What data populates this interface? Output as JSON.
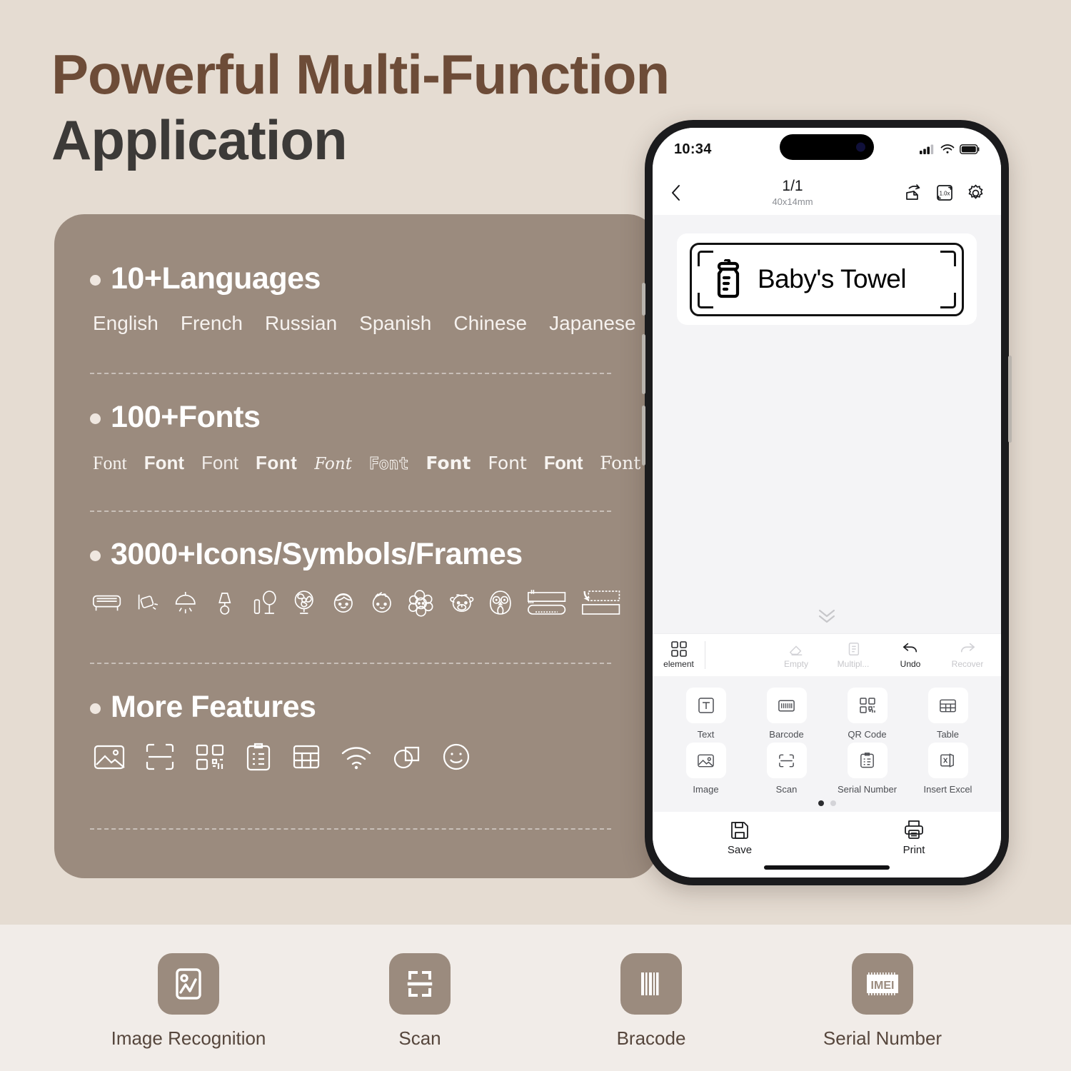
{
  "hero": {
    "title_line1": "Powerful Multi-Function",
    "title_line2": "Application",
    "colors": {
      "bg": "#e5dcd2",
      "title_brown": "#6d4c38",
      "title_dark": "#3c3a38",
      "card": "#9b8b7e",
      "strip_bg": "#f1ece8"
    }
  },
  "features": {
    "languages": {
      "heading": "10+Languages",
      "items": [
        "English",
        "French",
        "Russian",
        "Spanish",
        "Chinese",
        "Japanese"
      ]
    },
    "fonts": {
      "heading": "100+Fonts",
      "samples": [
        "Font",
        "Font",
        "Font",
        "Font",
        "Font",
        "Font",
        "Font",
        "Font",
        "Font",
        "Font"
      ]
    },
    "icons": {
      "heading": "3000+Icons/Symbols/Frames",
      "items": [
        "sofa-icon",
        "wall-lamp-icon",
        "ceiling-light-icon",
        "table-lamp-icon",
        "floor-lamp-icon",
        "fan-icon",
        "boy-face-icon",
        "child-face-icon",
        "poodle-icon",
        "cow-icon",
        "owl-icon",
        "banner-frame-icon",
        "label-frame-icon"
      ]
    },
    "more": {
      "heading": "More Features",
      "items": [
        "image-icon",
        "scan-icon",
        "qr-code-icon",
        "clipboard-icon",
        "table-icon",
        "wifi-icon",
        "shapes-icon",
        "smiley-icon"
      ]
    }
  },
  "phone": {
    "status": {
      "time": "10:34",
      "signal": "signal-icon",
      "wifi": "wifi-icon",
      "battery": "battery-icon"
    },
    "nav": {
      "back": "back-chevron-icon",
      "title": "1/1",
      "subtitle": "40x14mm",
      "actions": [
        "rotate-page-icon",
        "scale-1.0x-icon",
        "settings-gear-icon"
      ],
      "scale_label": "1.0x"
    },
    "label": {
      "text": "Baby's Towel",
      "icon": "baby-bottle-icon"
    },
    "toolbar": {
      "tab": {
        "label": "element",
        "icon": "grid-icon"
      },
      "actions": [
        {
          "label": "Empty",
          "icon": "eraser-icon",
          "enabled": false
        },
        {
          "label": "Multipl...",
          "icon": "duplicate-icon",
          "enabled": false
        },
        {
          "label": "Undo",
          "icon": "undo-icon",
          "enabled": true
        },
        {
          "label": "Recover",
          "icon": "redo-icon",
          "enabled": false
        }
      ]
    },
    "elements": [
      {
        "label": "Text",
        "icon": "text-icon"
      },
      {
        "label": "Barcode",
        "icon": "barcode-icon"
      },
      {
        "label": "QR Code",
        "icon": "qr-code-icon"
      },
      {
        "label": "Table",
        "icon": "table-icon"
      },
      {
        "label": "Image",
        "icon": "image-icon"
      },
      {
        "label": "Scan",
        "icon": "scan-icon"
      },
      {
        "label": "Serial Number",
        "icon": "serial-number-icon"
      },
      {
        "label": "Insert Excel",
        "icon": "excel-icon"
      }
    ],
    "pager": {
      "pages": 2,
      "current": 1
    },
    "bottom": [
      {
        "label": "Save",
        "icon": "save-icon"
      },
      {
        "label": "Print",
        "icon": "print-icon"
      }
    ]
  },
  "bottom_strip": [
    {
      "label": "Image Recognition",
      "icon": "image-recognition-icon"
    },
    {
      "label": "Scan",
      "icon": "scan-icon"
    },
    {
      "label": "Bracode",
      "icon": "barcode-icon"
    },
    {
      "label": "Serial Number",
      "icon": "imei-icon"
    }
  ]
}
